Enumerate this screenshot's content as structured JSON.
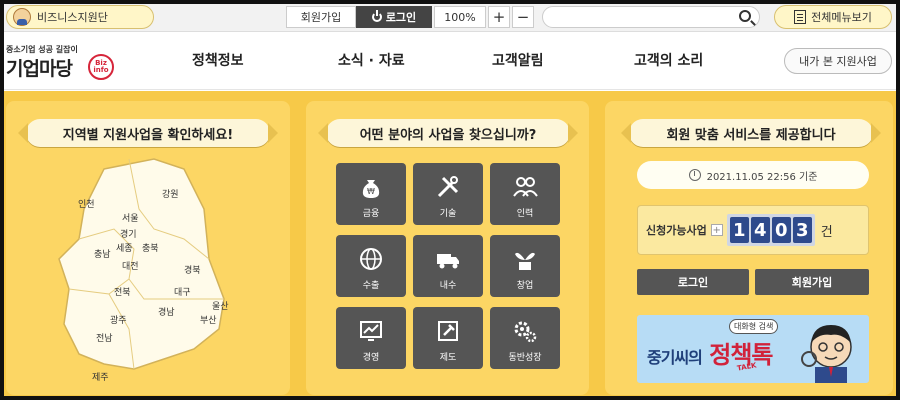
{
  "topbar": {
    "biz_team_label": "비즈니스지원단",
    "join_label": "회원가입",
    "login_label": "로그인",
    "zoom_level": "100%",
    "zoom_in": "+",
    "zoom_out": "−",
    "search_value": "",
    "all_menu_label": "전체메뉴보기"
  },
  "header": {
    "logo_tagline": "중소기업 성공 길잡이",
    "logo_name": "기업마당",
    "logo_badge": "Biz info",
    "nav": [
      "정책정보",
      "소식 · 자료",
      "고객알림",
      "고객의 소리"
    ],
    "my_business_label": "내가 본 지원사업"
  },
  "regional": {
    "title": "지역별 지원사업을 확인하세요!",
    "regions": [
      "인천",
      "서울",
      "강원",
      "경기",
      "충남",
      "세종",
      "충북",
      "대전",
      "경북",
      "전북",
      "대구",
      "울산",
      "광주",
      "경남",
      "부산",
      "전남",
      "제주"
    ]
  },
  "categories": {
    "title": "어떤 분야의 사업을 찾으십니까?",
    "items": [
      {
        "label": "금융",
        "icon": "money-bag-icon"
      },
      {
        "label": "기술",
        "icon": "tools-icon"
      },
      {
        "label": "인력",
        "icon": "people-icon"
      },
      {
        "label": "수출",
        "icon": "globe-icon"
      },
      {
        "label": "내수",
        "icon": "truck-icon"
      },
      {
        "label": "창업",
        "icon": "sprout-icon"
      },
      {
        "label": "경영",
        "icon": "chart-monitor-icon"
      },
      {
        "label": "제도",
        "icon": "gavel-icon"
      },
      {
        "label": "동반성장",
        "icon": "gears-icon"
      }
    ]
  },
  "member": {
    "title": "회원 맞춤 서비스를 제공합니다",
    "timestamp": "2021.11.05 22:56 기준",
    "available_label": "신청가능사업",
    "available_digits": [
      "1",
      "4",
      "0",
      "3"
    ],
    "available_unit": "건",
    "login_button": "로그인",
    "join_button": "회원가입",
    "promo_subtitle": "대화형 검색",
    "promo_title_prefix": "중기씨의",
    "promo_title_main": "정책톡",
    "promo_talk": "TALK"
  },
  "colors": {
    "main_bg": "#f7c948",
    "panel_bg": "#fcd664",
    "tile_bg": "#555555",
    "digit_bg": "#2e4a8c",
    "logo_accent": "#d6253a"
  }
}
